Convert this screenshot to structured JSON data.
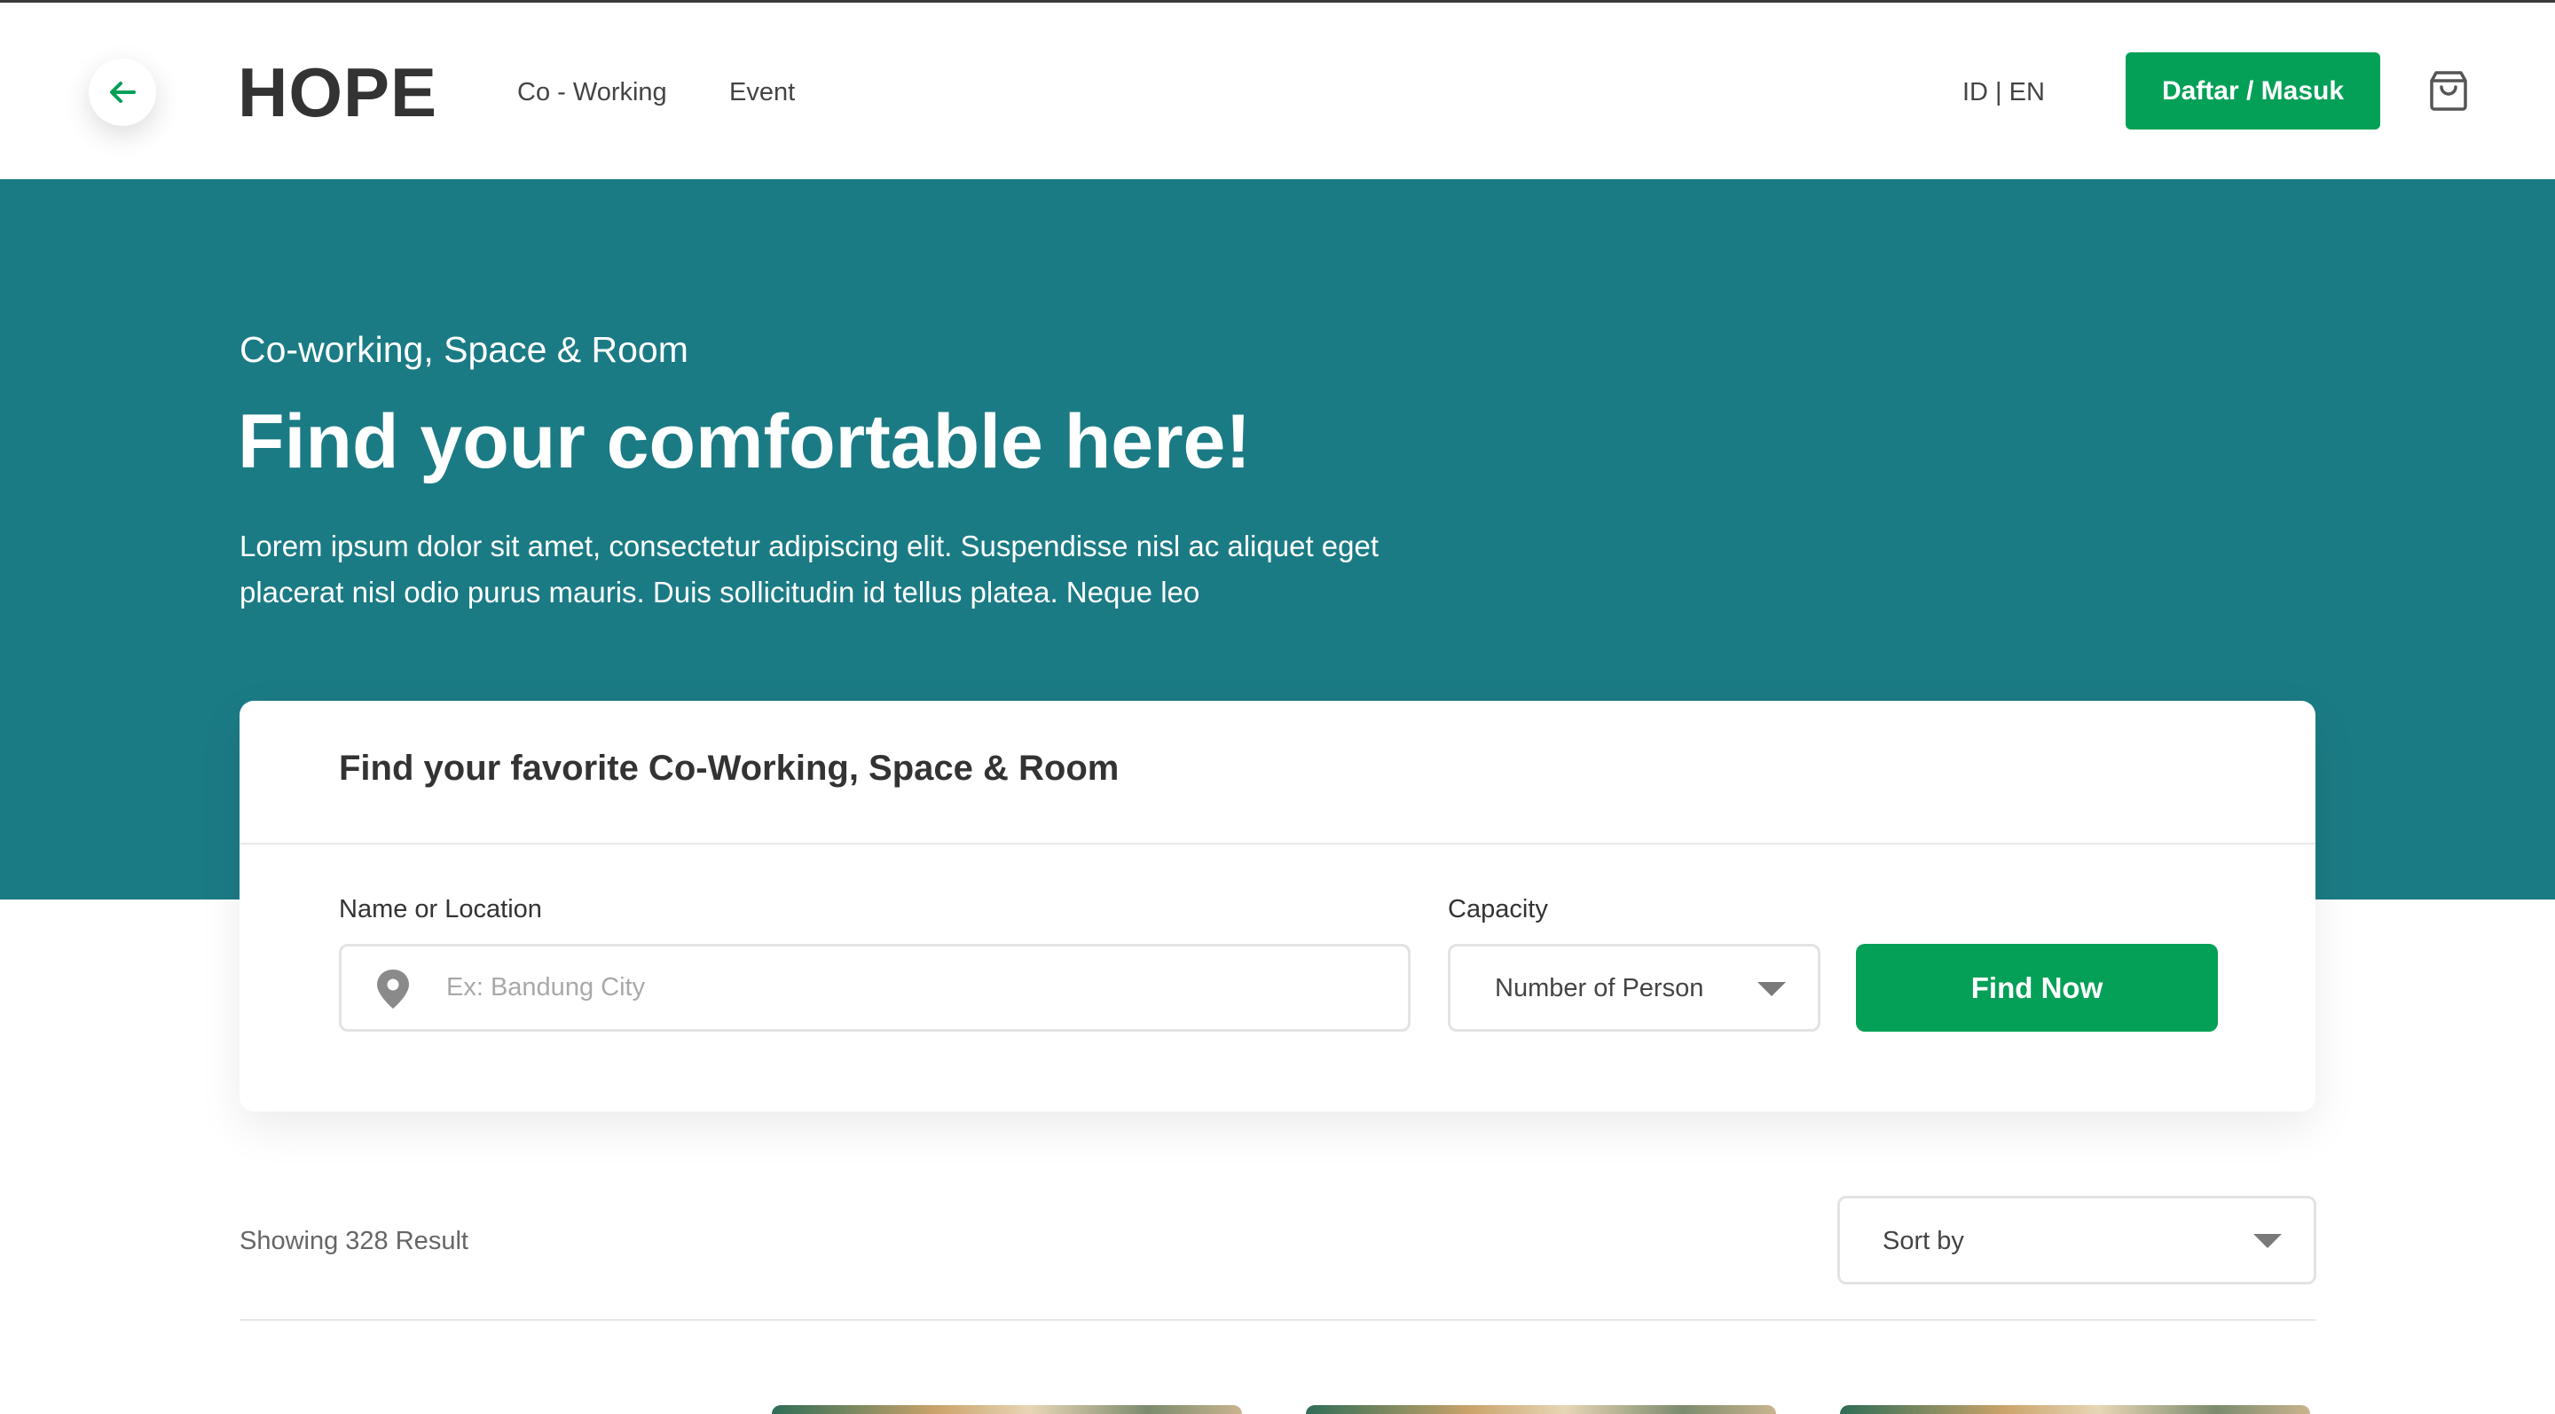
{
  "header": {
    "logo": "HOPE",
    "nav": [
      "Co - Working",
      "Event"
    ],
    "language": "ID | EN",
    "login_label": "Daftar / Masuk",
    "icons": {
      "back": "arrow-left-icon",
      "cart": "shopping-bag-icon"
    }
  },
  "hero": {
    "kicker": "Co-working, Space & Room",
    "title": "Find your comfortable here!",
    "description": "Lorem ipsum dolor sit amet, consectetur adipiscing elit. Suspendisse nisl ac aliquet eget placerat nisl odio purus mauris. Duis sollicitudin id tellus platea. Neque leo"
  },
  "search": {
    "title": "Find your favorite Co-Working, Space & Room",
    "location_label": "Name or Location",
    "location_placeholder": "Ex: Bandung City",
    "location_value": "",
    "capacity_label": "Capacity",
    "capacity_value": "Number of Person",
    "submit_label": "Find Now"
  },
  "results": {
    "count_text": "Showing 328 Result",
    "sort_value": "Sort by"
  },
  "colors": {
    "brand_green": "#04a057",
    "hero_teal": "#1b7b85",
    "text_dark": "#333333"
  }
}
